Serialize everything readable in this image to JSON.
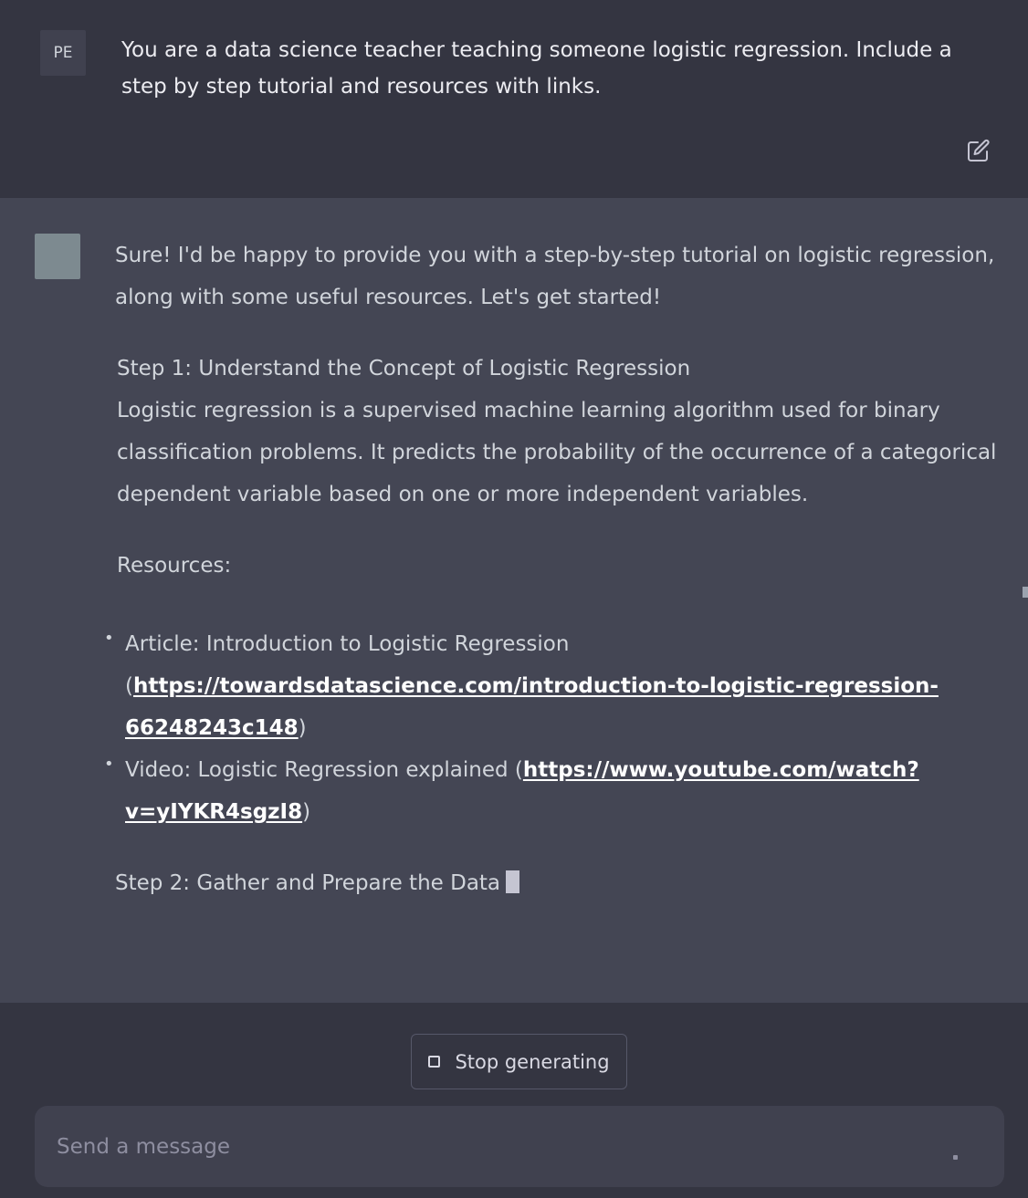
{
  "user": {
    "avatar_initials": "PE",
    "message": "You are a data science teacher teaching someone logistic regression. Include a step by step tutorial and resources with links."
  },
  "assistant": {
    "intro": "Sure! I'd be happy to provide you with a step-by-step tutorial on logistic regression, along with some useful resources. Let's get started!",
    "step1_title": "Step 1: Understand the Concept of Logistic Regression",
    "step1_body": "Logistic regression is a supervised machine learning algorithm used for binary classification problems. It predicts the probability of the occurrence of a categorical dependent variable based on one or more independent variables.",
    "resources_label": "Resources:",
    "resources": [
      {
        "prefix": "Article: Introduction to Logistic Regression (",
        "link": "https://towardsdatascience.com/introduction-to-logistic-regression-66248243c148",
        "suffix": ")"
      },
      {
        "prefix": "Video: Logistic Regression explained (",
        "link": "https://www.youtube.com/watch?v=yIYKR4sgzI8",
        "suffix": ")"
      }
    ],
    "step2_title": "Step 2: Gather and Prepare the Data"
  },
  "controls": {
    "stop_label": "Stop generating",
    "composer_placeholder": "Send a message"
  },
  "icons": {
    "edit": "edit-icon",
    "stop": "stop-icon"
  },
  "colors": {
    "page_bg": "#343541",
    "assistant_bg": "#444654",
    "composer_bg": "#40414f",
    "assistant_avatar": "#7d8a90"
  }
}
